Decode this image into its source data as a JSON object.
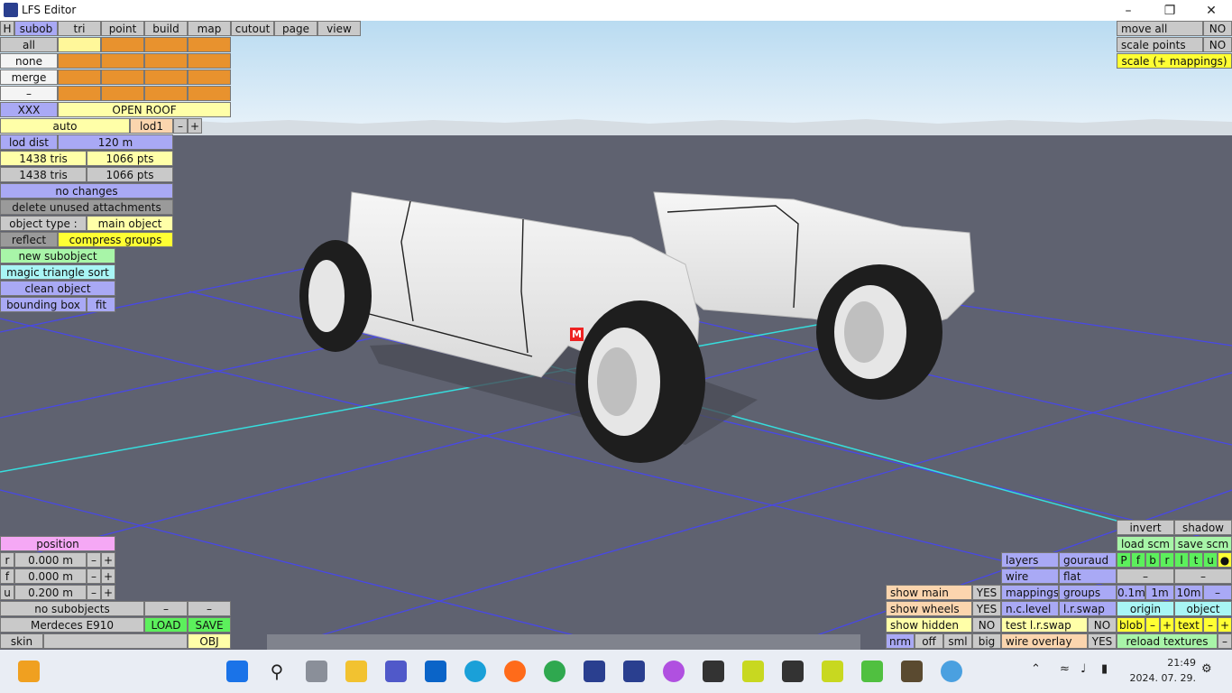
{
  "window": {
    "title": "LFS Editor",
    "minimize": "–",
    "maximize": "❐",
    "close": "✕"
  },
  "top_menu": [
    {
      "label": "H",
      "c": "c-gray"
    },
    {
      "label": "subob",
      "c": "c-blue"
    },
    {
      "label": "tri",
      "c": "c-gray"
    },
    {
      "label": "point",
      "c": "c-gray"
    },
    {
      "label": "build",
      "c": "c-gray"
    },
    {
      "label": "map",
      "c": "c-gray"
    },
    {
      "label": "cutout",
      "c": "c-gray"
    },
    {
      "label": "page",
      "c": "c-gray"
    },
    {
      "label": "view",
      "c": "c-gray"
    }
  ],
  "select": {
    "all": "all",
    "none": "none",
    "merge": "merge",
    "dash": "–",
    "xxx": "XXX",
    "open_roof": "OPEN ROOF"
  },
  "lod": {
    "auto": "auto",
    "lod1": "lod1",
    "minus": "–",
    "plus": "+"
  },
  "lod_dist": {
    "label": "lod dist",
    "value": "120 m"
  },
  "stats": {
    "tris1": "1438 tris",
    "pts1": "1066 pts",
    "tris2": "1438 tris",
    "pts2": "1066 pts"
  },
  "status": "no changes",
  "delete_unused": "delete unused attachments",
  "object_type": {
    "label": "object type :",
    "value": "main object"
  },
  "reflect": "reflect",
  "compress": "compress groups",
  "new_subobject": "new subobject",
  "magic_sort": "magic triangle sort",
  "clean_object": "clean object",
  "bounding_box": {
    "label": "bounding box",
    "fit": "fit"
  },
  "marker": "M",
  "position": {
    "title": "position",
    "rows": [
      {
        "axis": "r",
        "value": "0.000 m"
      },
      {
        "axis": "f",
        "value": "0.000 m"
      },
      {
        "axis": "u",
        "value": "0.200 m"
      }
    ],
    "minus": "–",
    "plus": "+"
  },
  "bottom_left": {
    "no_subobjects": "no subobjects",
    "dash": "–",
    "car_name": "Merdeces E910",
    "load": "LOAD",
    "save": "SAVE",
    "skin": "skin",
    "obj": "OBJ"
  },
  "top_right": {
    "move_all": "move all",
    "no1": "NO",
    "scale_points": "scale points",
    "no2": "NO",
    "scale_mappings": "scale (+ mappings)"
  },
  "br_main": {
    "show_main": "show main",
    "show_main_v": "YES",
    "show_wheels": "show wheels",
    "show_wheels_v": "YES",
    "show_hidden": "show hidden",
    "show_hidden_v": "NO",
    "nrm": "nrm",
    "off": "off",
    "sml": "sml",
    "big": "big"
  },
  "br_mid": {
    "layers": "layers",
    "gouraud": "gouraud",
    "wire": "wire",
    "flat": "flat",
    "mappings": "mappings",
    "groups": "groups",
    "nc_level": "n.c.level",
    "lr_swap": "l.r.swap",
    "test_lr": "test l.r.swap",
    "test_lr_v": "NO",
    "wire_overlay": "wire overlay",
    "wire_overlay_v": "YES"
  },
  "br_right": {
    "invert": "invert",
    "shadow": "shadow",
    "load_scm": "load scm",
    "save_scm": "save scm",
    "letters": [
      "P",
      "f",
      "b",
      "r",
      "l",
      "t",
      "u",
      "●"
    ],
    "dash": "–",
    "d01": "0.1m",
    "d1": "1m",
    "d10": "10m",
    "origin": "origin",
    "object": "object",
    "blob": "blob",
    "text": "text",
    "plus": "+",
    "reload": "reload textures"
  },
  "taskbar": {
    "time": "21:49",
    "date": "2024. 07. 29."
  },
  "colors": {
    "sky_top": "#b9dbf1",
    "ground": "#5f6270",
    "grid": "#4a4ae8",
    "axis": "#39e0e0"
  }
}
